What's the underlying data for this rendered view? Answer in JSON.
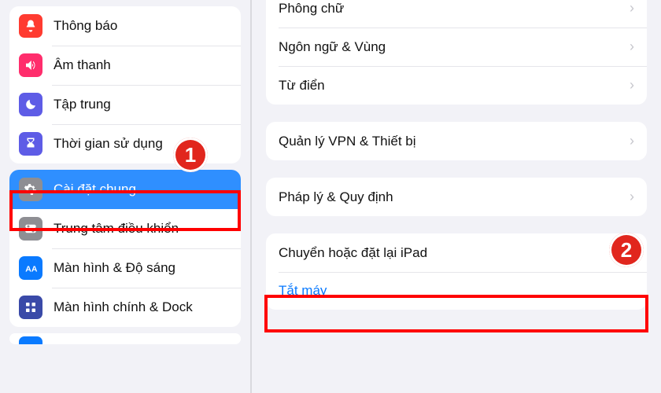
{
  "sidebar": {
    "group1": [
      {
        "label": "Thông báo"
      },
      {
        "label": "Âm thanh"
      },
      {
        "label": "Tập trung"
      },
      {
        "label": "Thời gian sử dụng"
      }
    ],
    "group2": [
      {
        "label": "Cài đặt chung"
      },
      {
        "label": "Trung tâm điều khiển"
      },
      {
        "label": "Màn hình & Độ sáng"
      },
      {
        "label": "Màn hình chính & Dock"
      }
    ]
  },
  "detail": {
    "group1": [
      {
        "label": "Phông chữ"
      },
      {
        "label": "Ngôn ngữ & Vùng"
      },
      {
        "label": "Từ điển"
      }
    ],
    "group2": [
      {
        "label": "Quản lý VPN & Thiết bị"
      }
    ],
    "group3": [
      {
        "label": "Pháp lý & Quy định"
      }
    ],
    "group4": [
      {
        "label": "Chuyển hoặc đặt lại iPad"
      },
      {
        "label": "Tắt máy"
      }
    ]
  },
  "annotations": {
    "one": "1",
    "two": "2"
  }
}
